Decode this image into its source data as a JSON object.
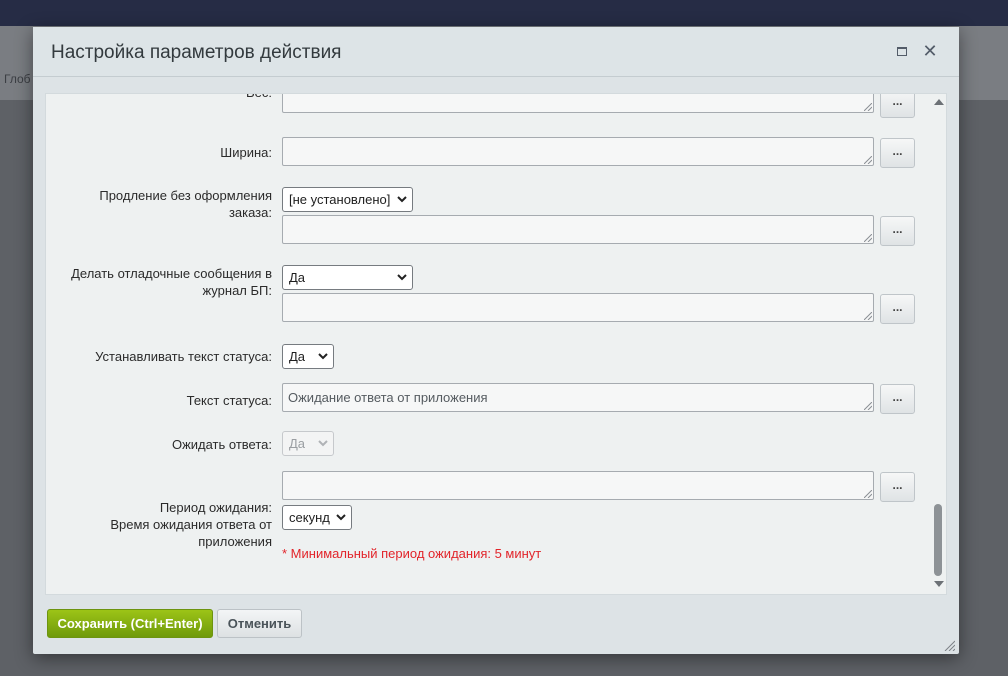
{
  "background": {
    "partial_text": "Глоб"
  },
  "dialog": {
    "title": "Настройка параметров действия",
    "maximize_icon": "maximize-icon",
    "close_glyph": "✕"
  },
  "fields": {
    "ves_label": "Вес:",
    "width_label": "Ширина:",
    "extension_label": "Продление без оформления заказа:",
    "extension_select": "[не установлено]",
    "debug_label": "Делать отладочные сообщения в журнал БП:",
    "debug_select": "Да",
    "set_status_label": "Устанавливать текст статуса:",
    "set_status_select": "Да",
    "status_text_label": "Текст статуса:",
    "status_text_value": "Ожидание ответа от приложения",
    "wait_label": "Ожидать ответа:",
    "wait_select": "Да",
    "period_label": "Период ожидания:",
    "period_sublabel": "Время ожидания ответа от приложения",
    "period_unit_select": "секунд",
    "period_note": "* Минимальный период ожидания: 5 минут",
    "dots_label": "..."
  },
  "footer": {
    "save_label": "Сохранить (Ctrl+Enter)",
    "cancel_label": "Отменить"
  },
  "colors": {
    "save_button": "#7fa80f",
    "note_text": "#e2242a",
    "header_bg": "#dde4e7"
  }
}
